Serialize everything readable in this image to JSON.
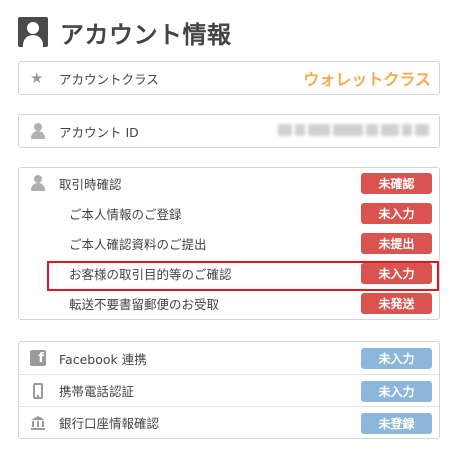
{
  "header": {
    "title": "アカウント情報",
    "icon": "account-person-icon"
  },
  "account_class": {
    "label": "アカウントクラス",
    "value": "ウォレットクラス",
    "value_color": "#f0ad4e"
  },
  "account_id": {
    "label": "アカウント ID"
  },
  "verification": {
    "label": "取引時確認",
    "status": "未確認",
    "items": [
      {
        "label": "ご本人情報のご登録",
        "status": "未入力"
      },
      {
        "label": "ご本人確認資料のご提出",
        "status": "未提出"
      },
      {
        "label": "お客様の取引目的等のご確認",
        "status": "未入力"
      },
      {
        "label": "転送不要書留郵便のお受取",
        "status": "未発送"
      }
    ]
  },
  "links": {
    "items": [
      {
        "label": "Facebook 連携",
        "status": "未入力",
        "icon": "facebook-icon"
      },
      {
        "label": "携帯電話認証",
        "status": "未入力",
        "icon": "mobile-phone-icon"
      },
      {
        "label": "銀行口座情報確認",
        "status": "未登録",
        "icon": "bank-icon"
      }
    ]
  },
  "colors": {
    "badge_red": "#d9534f",
    "badge_blue": "#8db7da",
    "highlight": "#e0181e"
  }
}
